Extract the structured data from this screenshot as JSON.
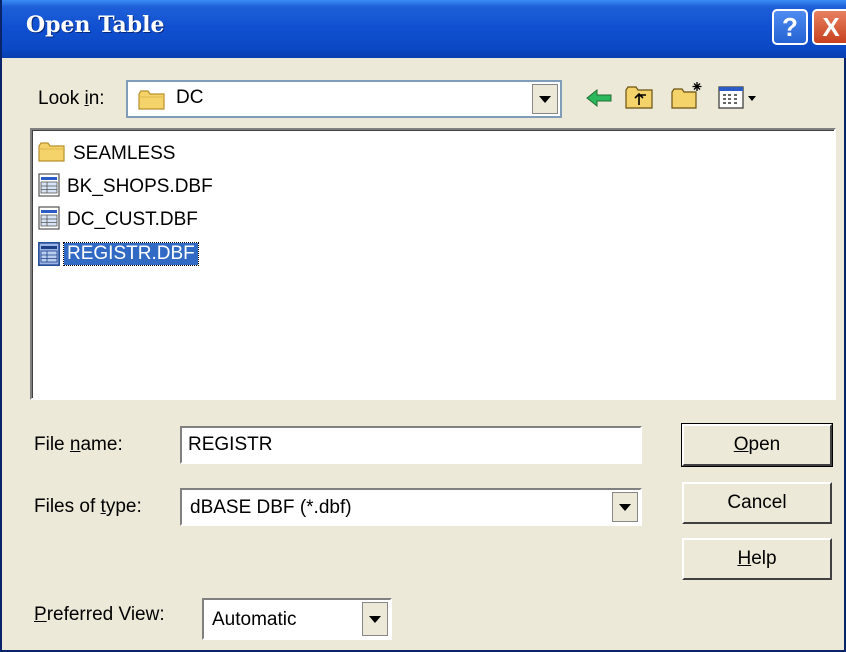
{
  "dialog": {
    "title": "Open Table"
  },
  "titlebar": {
    "help_glyph": "?",
    "close_glyph": "X"
  },
  "look_in": {
    "label_prefix": "Look ",
    "label_mnemonic": "i",
    "label_suffix": "n:",
    "value": "DC",
    "icon": "folder-icon"
  },
  "toolbar": {
    "icons": [
      "back-arrow-icon",
      "up-folder-icon",
      "new-folder-icon",
      "view-menu-icon"
    ]
  },
  "files": [
    {
      "name": "SEAMLESS",
      "icon": "folder-icon",
      "selected": false
    },
    {
      "name": "BK_SHOPS.DBF",
      "icon": "table-file-icon",
      "selected": false
    },
    {
      "name": "DC_CUST.DBF",
      "icon": "table-file-icon",
      "selected": false
    },
    {
      "name": "REGISTR.DBF",
      "icon": "table-file-icon",
      "selected": true
    }
  ],
  "file_name": {
    "label_prefix": "File ",
    "label_mnemonic": "n",
    "label_suffix": "ame:",
    "value": "REGISTR"
  },
  "file_type": {
    "label_prefix": "Files of ",
    "label_mnemonic": "t",
    "label_suffix": "ype:",
    "value": "dBASE DBF (*.dbf)"
  },
  "preferred_view": {
    "label_mnemonic": "P",
    "label_suffix": "referred View:",
    "value": "Automatic"
  },
  "buttons": {
    "open": {
      "mnemonic": "O",
      "rest": "pen"
    },
    "cancel": {
      "label": "Cancel"
    },
    "help": {
      "mnemonic": "H",
      "rest": "elp"
    }
  },
  "colors": {
    "titlebar": "#0b48c4",
    "selection": "#316ac5",
    "dialog_bg": "#ece9d8"
  }
}
